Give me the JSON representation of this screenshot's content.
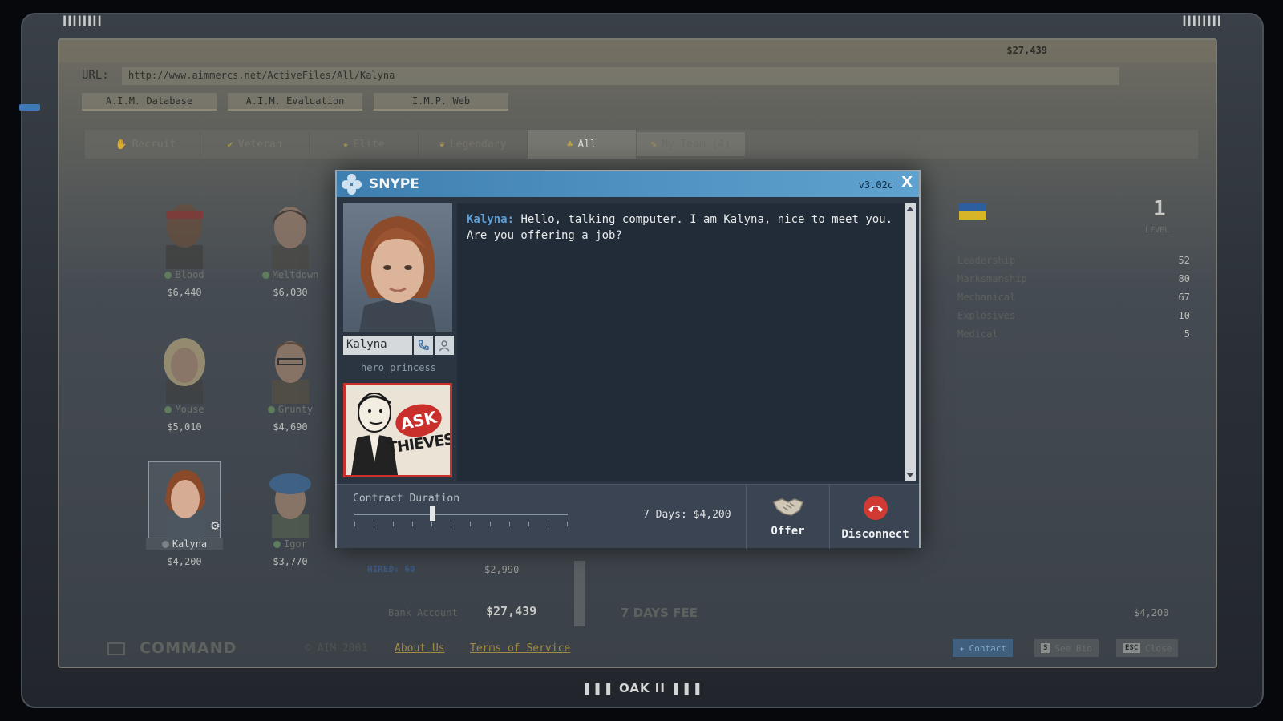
{
  "frame": {
    "grill_left": "ǀǀǀǀǀǀǀǀ",
    "grill_right": "ǀǀǀǀǀǀǀǀ",
    "footer_brand": "❚❚❚ OAK II ❚❚❚"
  },
  "topbar": {
    "money": "$27,439"
  },
  "browser": {
    "url_label": "URL:",
    "url": "http://www.aimmercs.net/ActiveFiles/All/Kalyna",
    "nav_tabs": [
      {
        "label": "A.I.M. Database"
      },
      {
        "label": "A.I.M. Evaluation"
      },
      {
        "label": "I.M.P. Web"
      }
    ]
  },
  "filters": [
    {
      "label": "Recruit",
      "icon": "✋"
    },
    {
      "label": "Veteran",
      "icon": "✔"
    },
    {
      "label": "Elite",
      "icon": "★"
    },
    {
      "label": "Legendary",
      "icon": "❦"
    },
    {
      "label": "All",
      "icon": "♣"
    },
    {
      "label": "My Team (4)",
      "icon": "✎"
    }
  ],
  "mercs": [
    {
      "name": "Blood",
      "price": "$6,440"
    },
    {
      "name": "Meltdown",
      "price": "$6,030"
    },
    {
      "name": "Mouse",
      "price": "$5,010"
    },
    {
      "name": "Grunty",
      "price": "$4,690"
    },
    {
      "name": "Kalyna",
      "price": "$4,200"
    },
    {
      "name": "Igor",
      "price": "$3,770"
    }
  ],
  "hired_label": "HIRED: 60",
  "hired_price": "$2,990",
  "bank": {
    "label": "Bank Account",
    "value": "$27,439"
  },
  "profile": {
    "level": "1",
    "level_label": "LEVEL",
    "skills": [
      {
        "name": "Leadership",
        "value": "52"
      },
      {
        "name": "Marksmanship",
        "value": "80"
      },
      {
        "name": "Mechanical",
        "value": "67"
      },
      {
        "name": "Explosives",
        "value": "10"
      },
      {
        "name": "Medical",
        "value": "5"
      }
    ],
    "fee_label": "7 DAYS FEE",
    "fee_value": "$4,200"
  },
  "footer": {
    "command": "COMMAND",
    "copyright": "© AIM 2001",
    "about": "About Us",
    "terms": "Terms of Service",
    "contact": "Contact",
    "see_bio": "See Bio",
    "see_bio_key": "S",
    "close": "Close",
    "close_key": "ESC"
  },
  "snype": {
    "title": "SNYPE",
    "version": "v3.02c",
    "close": "X",
    "contact_name": "Kalyna",
    "handle": "hero_princess",
    "ad_ask": "ASK",
    "ad_thieves": "THIEVES",
    "chat": [
      {
        "speaker": "Kalyna:",
        "text": "Hello, talking computer. I am Kalyna, nice to meet you. Are you offering a job?"
      }
    ],
    "contract_label": "Contract Duration",
    "contract_value": "7 Days: $4,200",
    "contract_days": 7,
    "offer_label": "Offer",
    "disconnect_label": "Disconnect"
  },
  "colors": {
    "snype_blue": "#3e7fb0",
    "disconnect_red": "#d13a33",
    "link_gold": "#a08a44"
  }
}
